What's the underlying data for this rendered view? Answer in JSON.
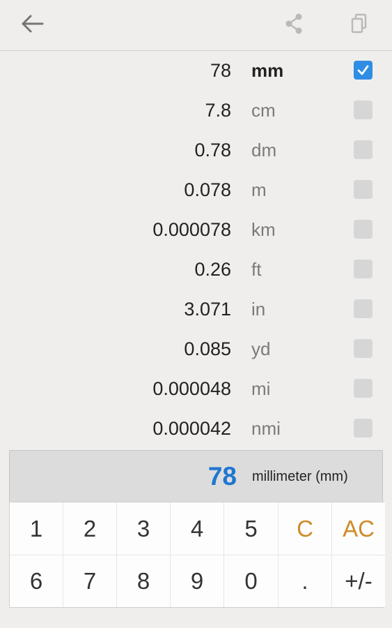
{
  "toolbar": {
    "back_icon": "arrow-left-icon",
    "share_icon": "share-icon",
    "copy_icon": "copy-icon"
  },
  "units": [
    {
      "value": "78",
      "abbr": "mm",
      "checked": true
    },
    {
      "value": "7.8",
      "abbr": "cm",
      "checked": false
    },
    {
      "value": "0.78",
      "abbr": "dm",
      "checked": false
    },
    {
      "value": "0.078",
      "abbr": "m",
      "checked": false
    },
    {
      "value": "0.000078",
      "abbr": "km",
      "checked": false
    },
    {
      "value": "0.26",
      "abbr": "ft",
      "checked": false
    },
    {
      "value": "3.071",
      "abbr": "in",
      "checked": false
    },
    {
      "value": "0.085",
      "abbr": "yd",
      "checked": false
    },
    {
      "value": "0.000048",
      "abbr": "mi",
      "checked": false
    },
    {
      "value": "0.000042",
      "abbr": "nmi",
      "checked": false
    }
  ],
  "display": {
    "value": "78",
    "unit_name": "millimeter (mm)"
  },
  "keypad": {
    "keys": [
      "1",
      "2",
      "3",
      "4",
      "5",
      "C",
      "AC",
      "6",
      "7",
      "8",
      "9",
      "0",
      ".",
      "+/-"
    ]
  },
  "colors": {
    "accent_blue": "#1f76d2",
    "checkbox_checked": "#2f8de4",
    "checkbox_unchecked": "#d6d6d6",
    "clear_keys": "#cf8a2a",
    "background": "#efeeec"
  }
}
